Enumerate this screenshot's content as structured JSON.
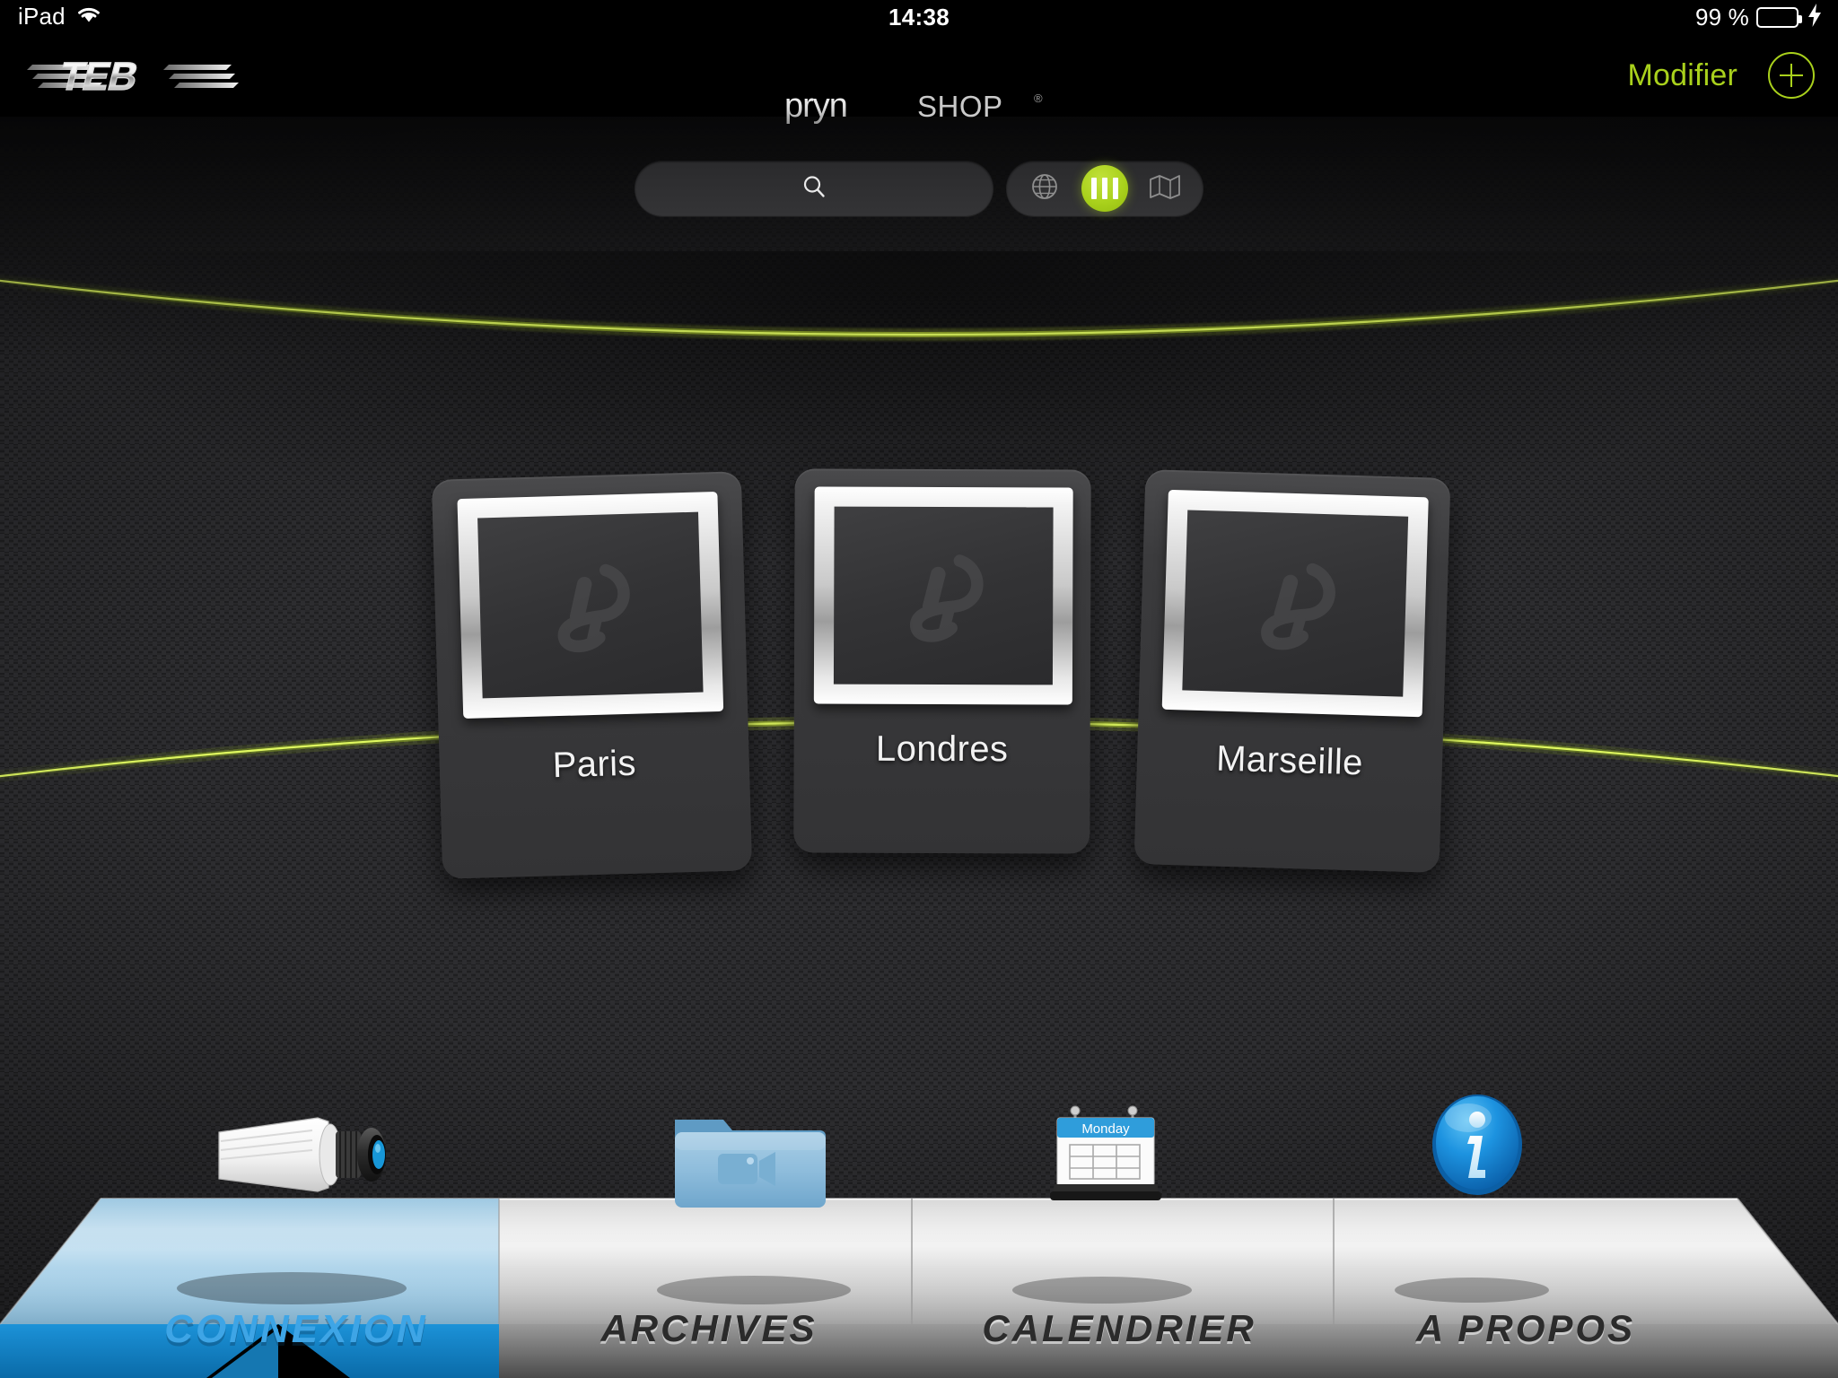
{
  "statusbar": {
    "device": "iPad",
    "wifi_icon": "wifi-icon",
    "time": "14:38",
    "battery_percent": "99 %",
    "battery_icon": "battery-icon",
    "charging_icon": "lightning-bolt-icon"
  },
  "navbar": {
    "logo_left": "TEB",
    "logo_left_icon": "teb-logo-icon",
    "brand_primary": "pryn",
    "brand_secondary": "SHOP",
    "brand_trademark": "®",
    "edit_label": "Modifier",
    "add_label": "+",
    "add_icon": "plus-circle-icon",
    "accent_color": "#a9d11c"
  },
  "search": {
    "value": "",
    "placeholder": "",
    "icon": "search-icon"
  },
  "view_toggle": {
    "options": [
      {
        "id": "globe",
        "icon": "globe-icon",
        "label": "Globe",
        "active": false
      },
      {
        "id": "grid",
        "icon": "columns-icon",
        "label": "Grille",
        "active": true
      },
      {
        "id": "map",
        "icon": "map-icon",
        "label": "Carte",
        "active": false
      }
    ],
    "active_color": "#a9d11c"
  },
  "cameras": [
    {
      "name": "Paris",
      "thumb_icon": "pryn-placeholder-icon"
    },
    {
      "name": "Londres",
      "thumb_icon": "pryn-placeholder-icon"
    },
    {
      "name": "Marseille",
      "thumb_icon": "pryn-placeholder-icon"
    }
  ],
  "tabs": [
    {
      "id": "connexion",
      "label": "CONNEXION",
      "icon": "cctv-camera-icon",
      "active": true
    },
    {
      "id": "archives",
      "label": "ARCHIVES",
      "icon": "video-folder-icon",
      "active": false
    },
    {
      "id": "calendrier",
      "label": "CALENDRIER",
      "icon": "calendar-icon",
      "active": false,
      "icon_day": "Monday"
    },
    {
      "id": "apropos",
      "label": "A PROPOS",
      "icon": "info-circle-icon",
      "active": false
    }
  ],
  "theme": {
    "background": "#232325",
    "accent_green": "#a9d11c",
    "accent_blue": "#1c92d8",
    "nav_background": "#000000"
  }
}
